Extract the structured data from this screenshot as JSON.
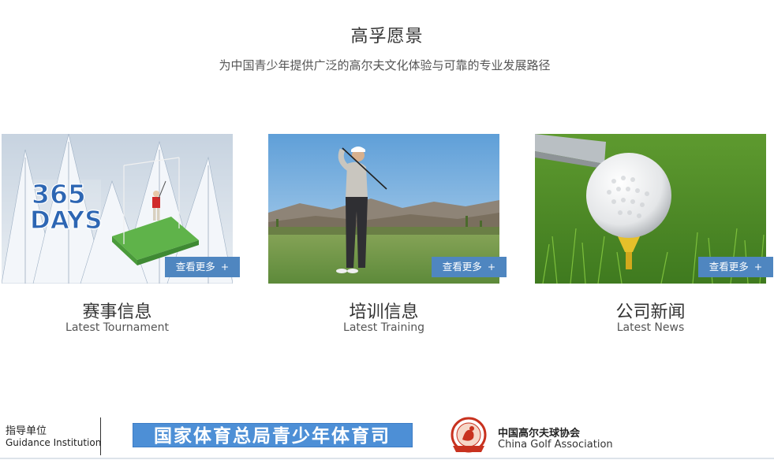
{
  "section": {
    "title": "高孚愿景",
    "subtitle": "为中国青少年提供广泛的高尔夫文化体验与可靠的专业发展路径"
  },
  "cards": [
    {
      "title": "赛事信息",
      "subtitle": "Latest Tournament",
      "more_label": "查看更多",
      "more_icon": "+",
      "image_text": {
        "line1": "365",
        "line2": "DAYS"
      }
    },
    {
      "title": "培训信息",
      "subtitle": "Latest Training",
      "more_label": "查看更多",
      "more_icon": "+"
    },
    {
      "title": "公司新闻",
      "subtitle": "Latest News",
      "more_label": "查看更多",
      "more_icon": "+"
    }
  ],
  "footer": {
    "guide_label": "指导单位",
    "guide_label_en": "Guidance Institution",
    "banner_text": "国家体育总局青少年体育司",
    "association_cn": "中国高尔夫球协会",
    "association_en": "China Golf Association"
  },
  "colors": {
    "button_bg": "#4f86c0",
    "text_dark": "#333333",
    "banner_blue": "#3d7fc9",
    "logo_red": "#c8321f"
  }
}
